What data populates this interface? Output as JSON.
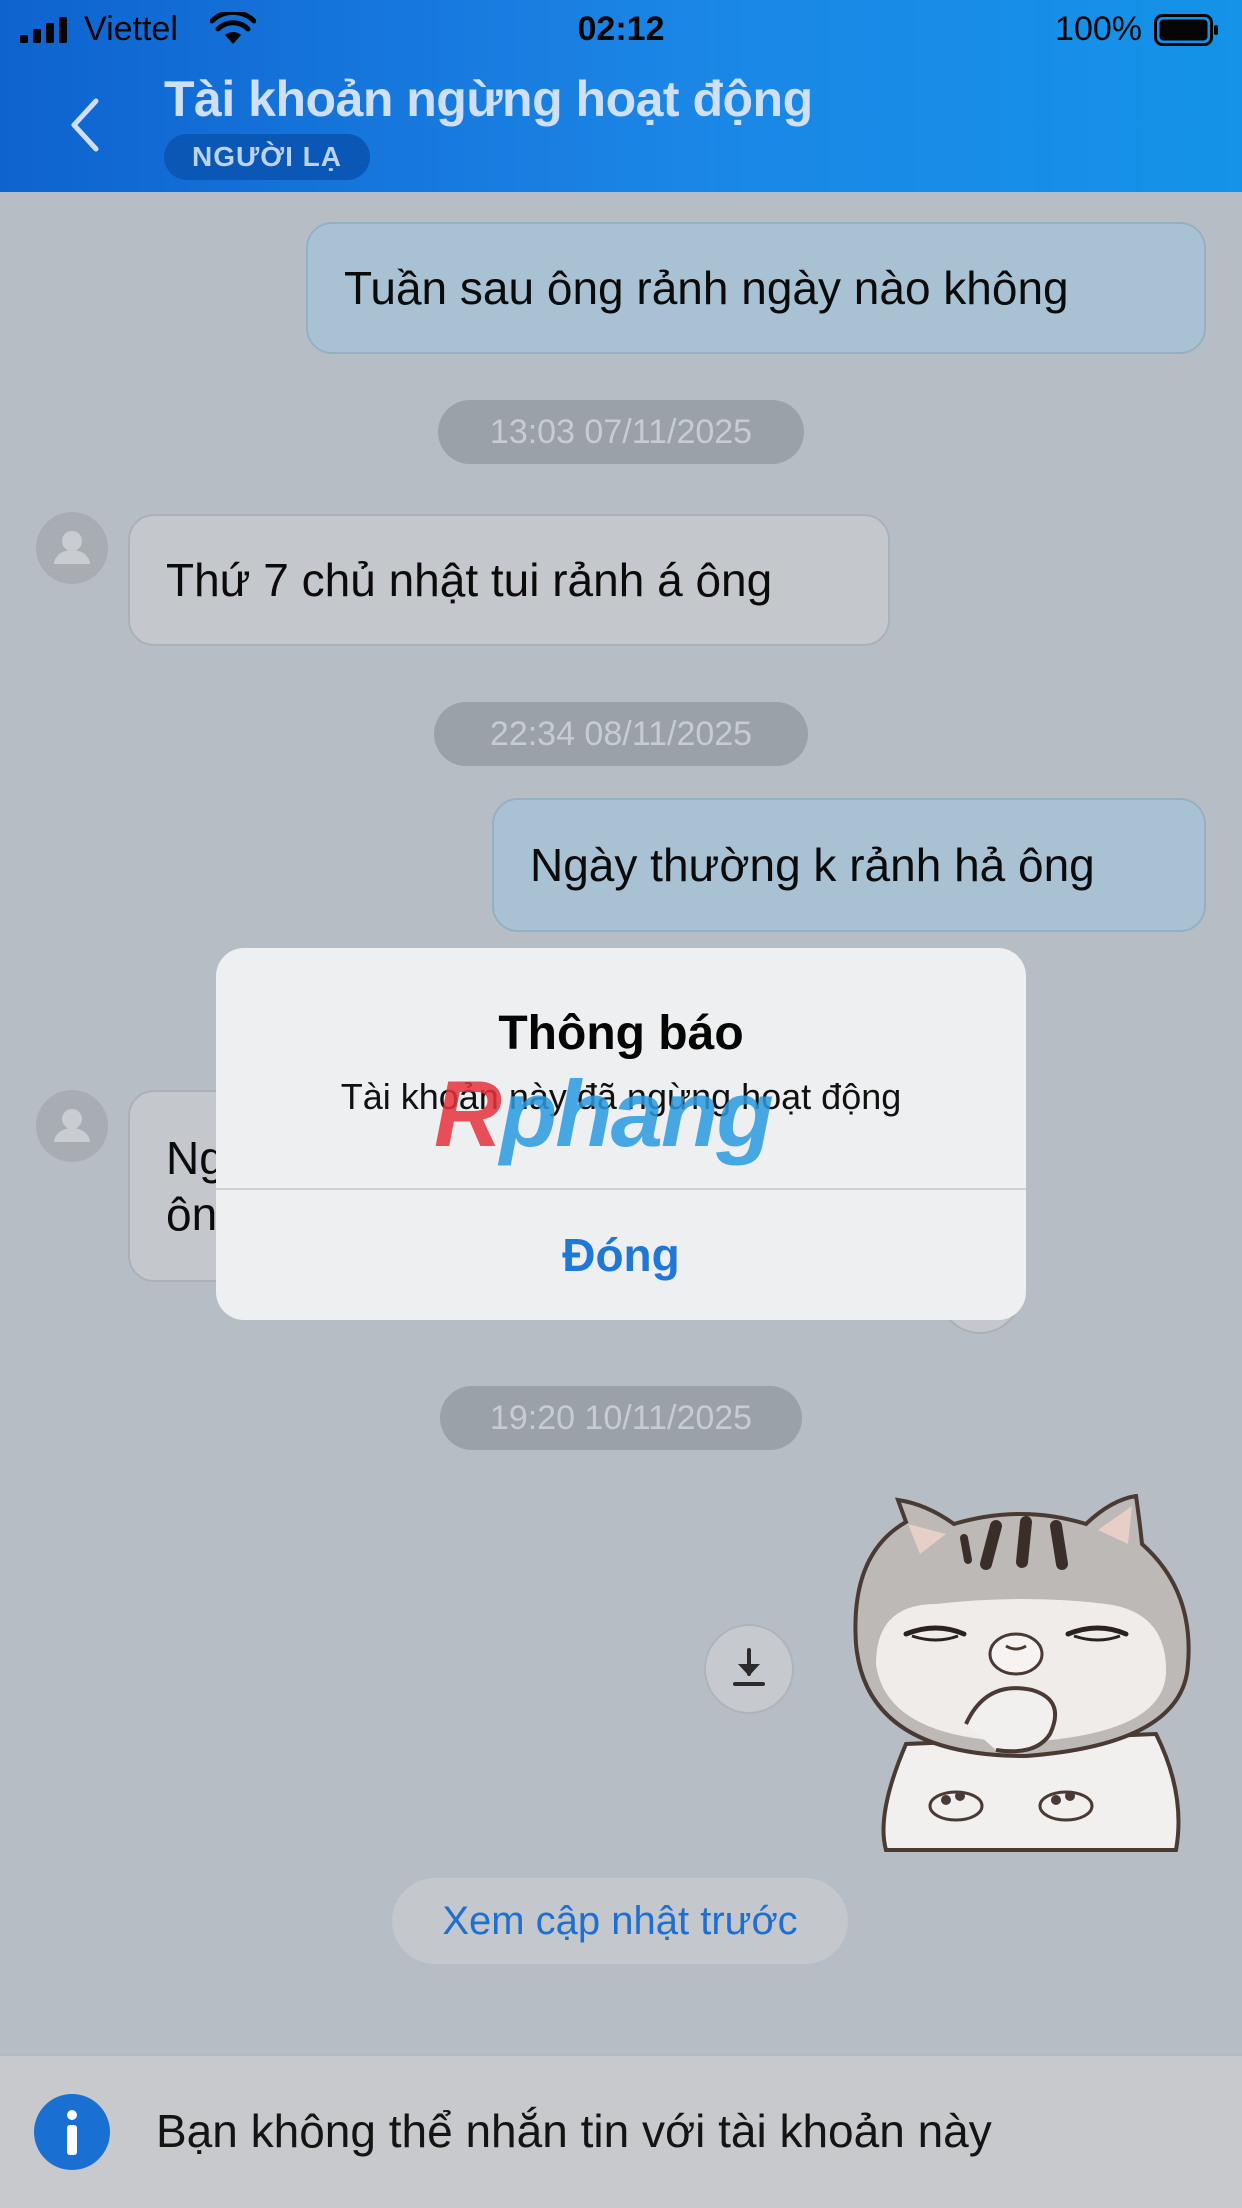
{
  "status_bar": {
    "carrier": "Viettel",
    "time": "02:12",
    "battery": "100%"
  },
  "header": {
    "title": "Tài khoản ngừng hoạt động",
    "badge": "NGƯỜI LẠ"
  },
  "messages": [
    {
      "type": "sent",
      "text": "Tuần sau ông rảnh ngày nào không"
    },
    {
      "type": "timestamp",
      "text": "13:03 07/11/2025"
    },
    {
      "type": "received",
      "text": "Thứ 7 chủ nhật tui rảnh á ông"
    },
    {
      "type": "timestamp",
      "text": "22:34 08/11/2025"
    },
    {
      "type": "sent",
      "text": "Ngày thường k rảnh hả ông"
    },
    {
      "type": "received",
      "text_line1": "Ng",
      "text_line2": "ôn"
    },
    {
      "type": "timestamp",
      "text": "19:20 10/11/2025"
    }
  ],
  "sticker": {
    "name": "cat-sticker"
  },
  "prev_updates_label": "Xem cập nhật trước",
  "notice_text": "Bạn không thể nhắn tin với tài khoản này",
  "alert": {
    "title": "Thông báo",
    "message": "Tài khoản này đã ngừng hoạt động",
    "button": "Đóng"
  },
  "watermark": {
    "part1": "R",
    "part2": "phang"
  },
  "colors": {
    "header_start": "#0f63cf",
    "header_end": "#1493e8",
    "accent": "#1f77d6",
    "chat_background": "#b7bdc4"
  }
}
